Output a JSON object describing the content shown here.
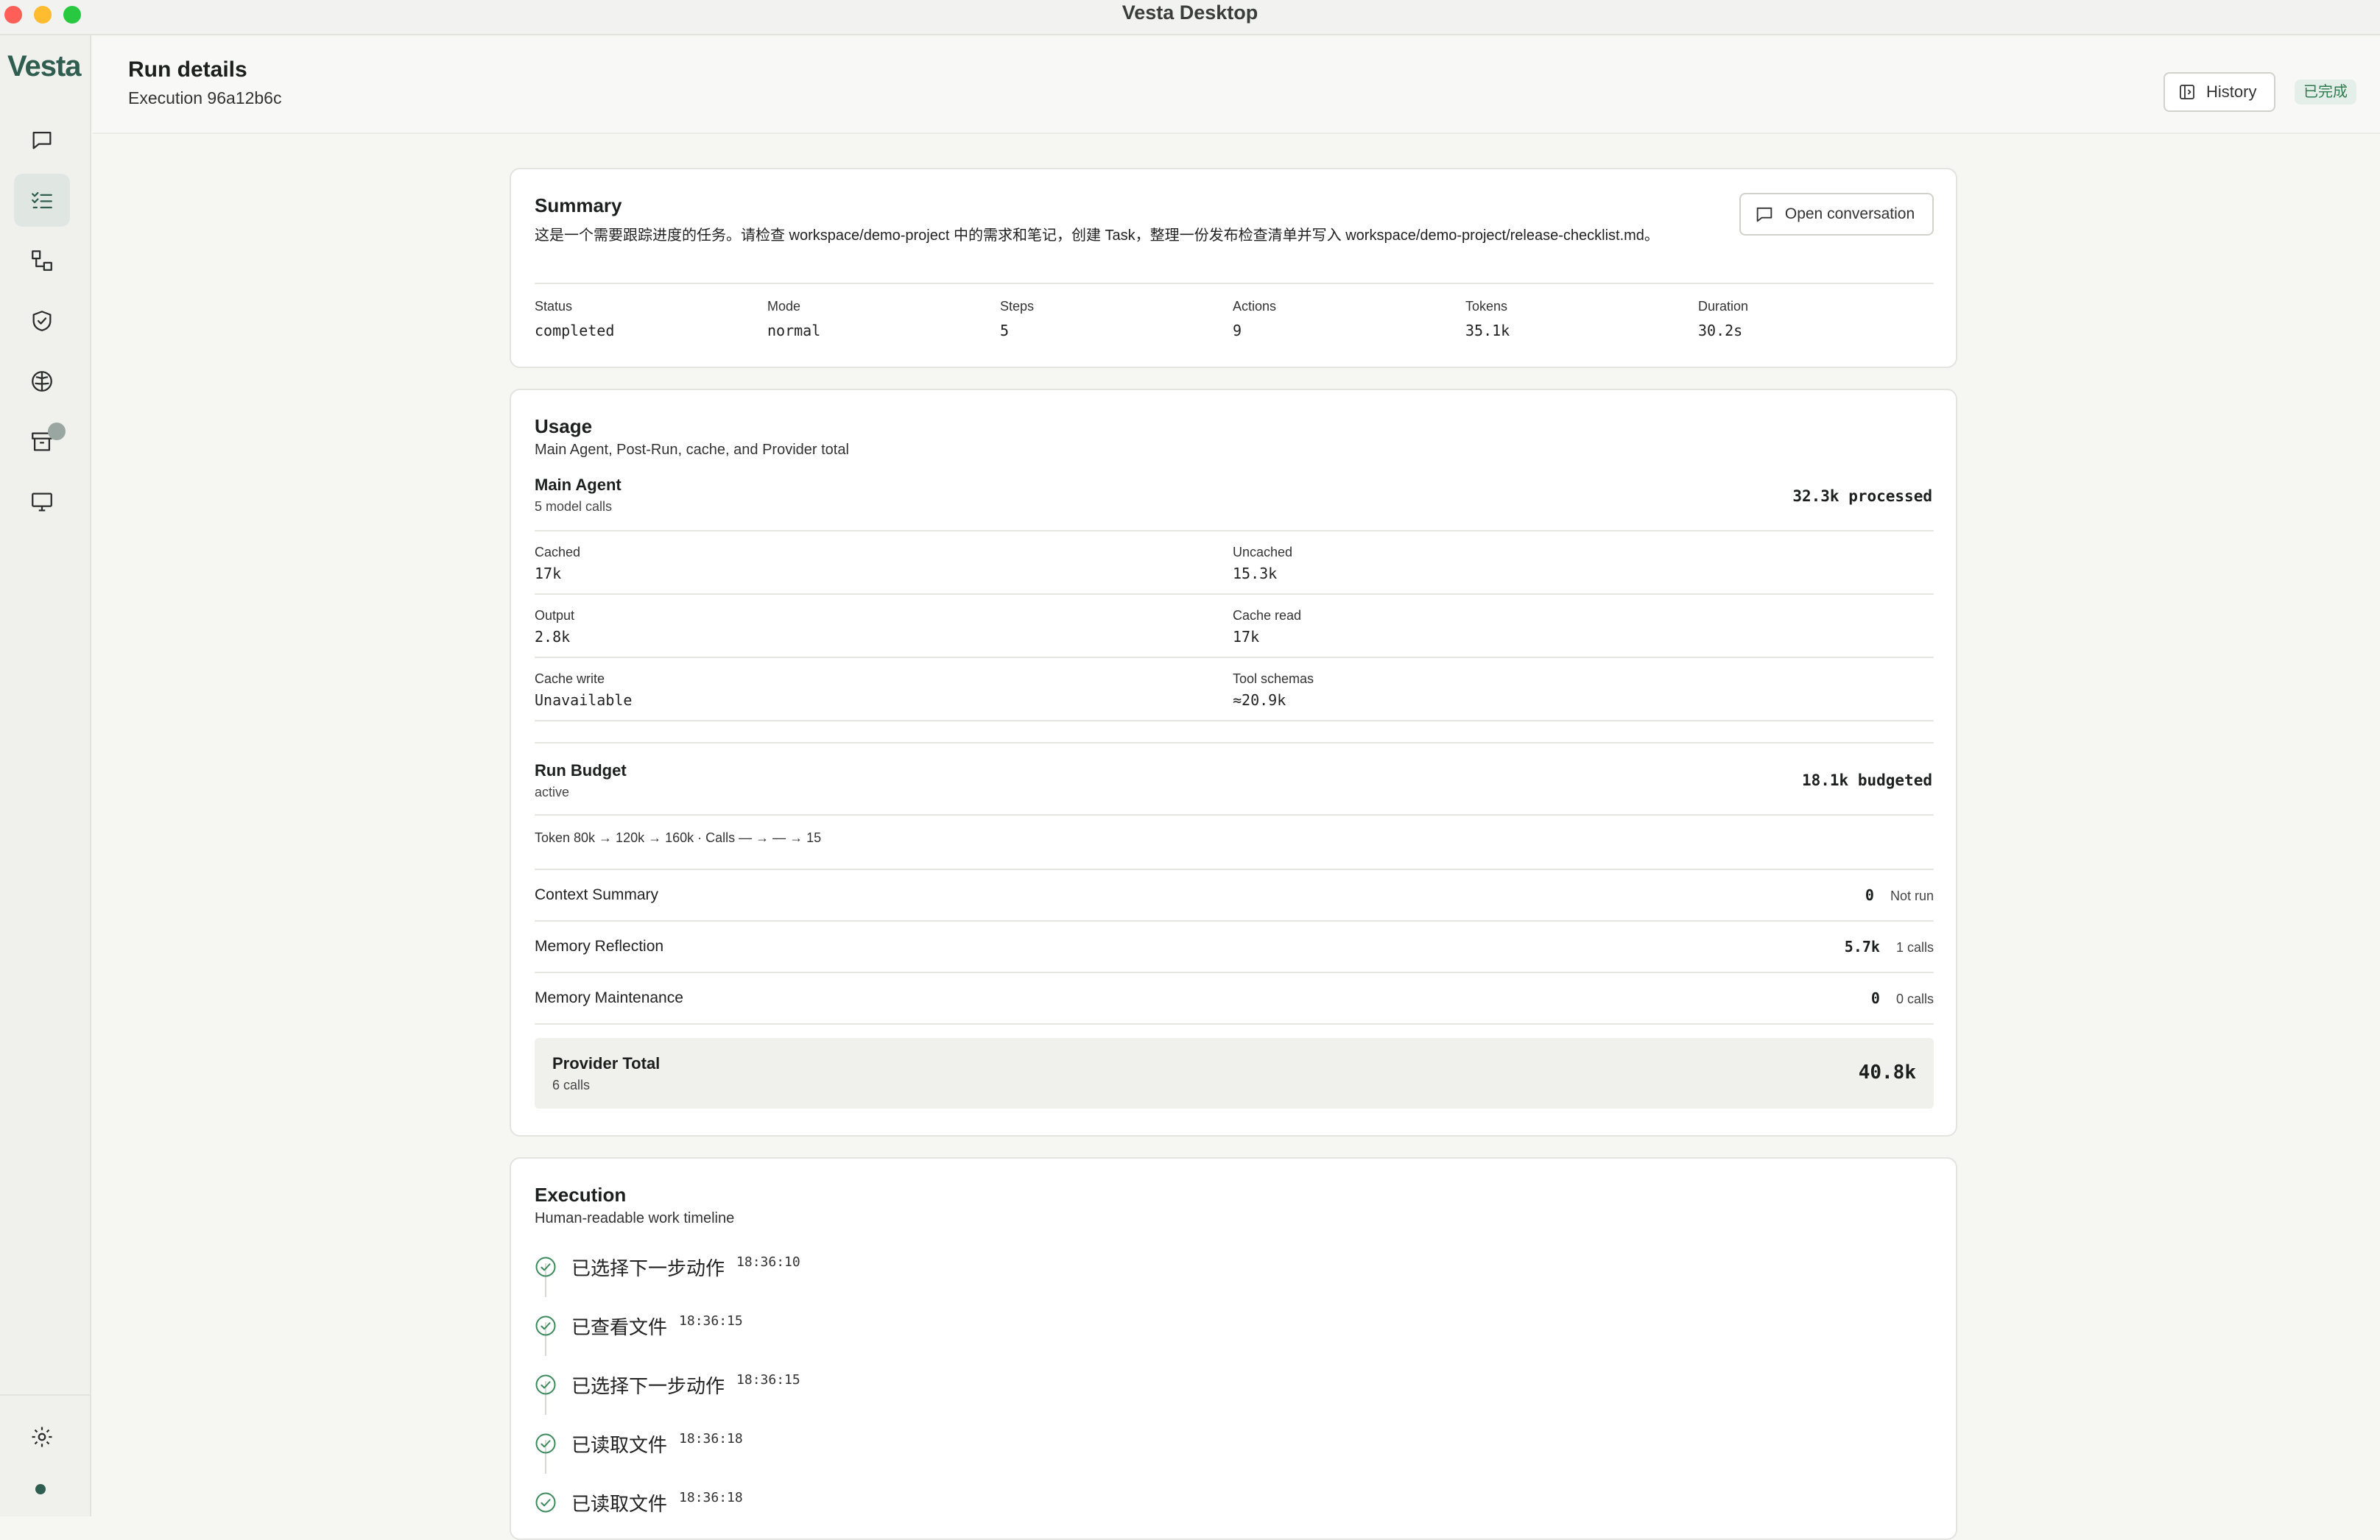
{
  "window": {
    "title": "Vesta Desktop"
  },
  "sidebar": {
    "logo": "Vesta",
    "items": [
      {
        "icon": "chat-icon",
        "active": false
      },
      {
        "icon": "checklist-icon",
        "active": true
      },
      {
        "icon": "workflow-icon",
        "active": false
      },
      {
        "icon": "shield-check-icon",
        "active": false
      },
      {
        "icon": "brain-icon",
        "active": false
      },
      {
        "icon": "archive-icon",
        "active": false,
        "badge": true
      },
      {
        "icon": "monitor-icon",
        "active": false
      }
    ],
    "settings_icon": "gear-icon"
  },
  "header": {
    "title": "Run details",
    "subtitle": "Execution 96a12b6c",
    "history_label": "History",
    "status_badge": "已完成"
  },
  "summary": {
    "title": "Summary",
    "description": "这是一个需要跟踪进度的任务。请检查 workspace/demo-project 中的需求和笔记，创建 Task，整理一份发布检查清单并写入 workspace/demo-project/release-checklist.md。",
    "open_conversation_label": "Open conversation",
    "stats": [
      {
        "label": "Status",
        "value": "completed"
      },
      {
        "label": "Mode",
        "value": "normal"
      },
      {
        "label": "Steps",
        "value": "5"
      },
      {
        "label": "Actions",
        "value": "9"
      },
      {
        "label": "Tokens",
        "value": "35.1k"
      },
      {
        "label": "Duration",
        "value": "30.2s"
      }
    ]
  },
  "usage": {
    "title": "Usage",
    "subtitle": "Main Agent, Post-Run, cache, and Provider total",
    "main_agent": {
      "title": "Main Agent",
      "calls": "5 model calls",
      "processed": "32.3k processed",
      "metrics": [
        {
          "label": "Cached",
          "value": "17k"
        },
        {
          "label": "Uncached",
          "value": "15.3k"
        },
        {
          "label": "Output",
          "value": "2.8k"
        },
        {
          "label": "Cache read",
          "value": "17k"
        },
        {
          "label": "Cache write",
          "value": "Unavailable"
        },
        {
          "label": "Tool schemas",
          "value": "≈20.9k"
        }
      ]
    },
    "run_budget": {
      "title": "Run Budget",
      "state": "active",
      "budgeted": "18.1k budgeted",
      "detail": "Token 80k → 120k → 160k · Calls — → — → 15"
    },
    "post_run": [
      {
        "name": "Context Summary",
        "value": "0",
        "note": "Not run"
      },
      {
        "name": "Memory Reflection",
        "value": "5.7k",
        "note": "1 calls"
      },
      {
        "name": "Memory Maintenance",
        "value": "0",
        "note": "0 calls"
      }
    ],
    "provider_total": {
      "title": "Provider Total",
      "calls": "6 calls",
      "value": "40.8k"
    }
  },
  "execution": {
    "title": "Execution",
    "subtitle": "Human-readable work timeline",
    "timeline": [
      {
        "label": "已选择下一步动作",
        "time": "18:36:10"
      },
      {
        "label": "已查看文件",
        "time": "18:36:15"
      },
      {
        "label": "已选择下一步动作",
        "time": "18:36:15"
      },
      {
        "label": "已读取文件",
        "time": "18:36:18"
      },
      {
        "label": "已读取文件",
        "time": "18:36:18"
      }
    ]
  }
}
